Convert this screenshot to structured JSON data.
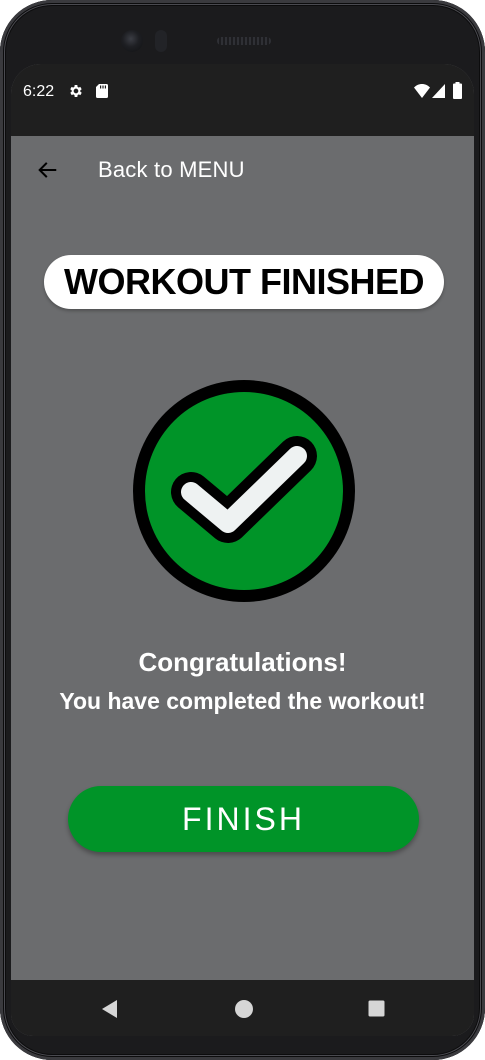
{
  "status_bar": {
    "time": "6:22",
    "icons": [
      "gear-icon",
      "sd-card-icon",
      "wifi-icon",
      "signal-icon",
      "battery-icon"
    ]
  },
  "app_bar": {
    "back_icon": "arrow-back-icon",
    "back_label": "Back to MENU"
  },
  "main": {
    "title": "WORKOUT FINISHED",
    "success_icon": "check-circle-icon",
    "congrats": "Congratulations!",
    "message": "You have completed the workout!",
    "finish_label": "FINISH"
  },
  "nav_bar": {
    "icons": [
      "nav-back-icon",
      "nav-home-icon",
      "nav-recents-icon"
    ]
  },
  "colors": {
    "screen_background": "#6b6c6e",
    "system_bars": "#1f1f1f",
    "accent_green": "#009428",
    "check_mark": "#eef2f2",
    "title_pill": "#ffffff"
  }
}
